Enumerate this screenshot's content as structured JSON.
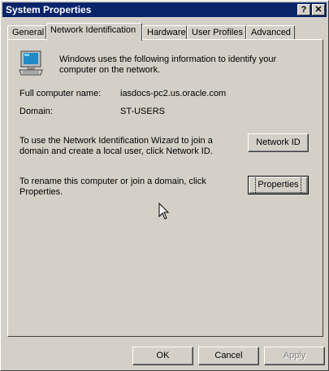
{
  "window": {
    "title": "System Properties",
    "help_button": "?",
    "close_button": "✕"
  },
  "tabs": [
    {
      "label": "General",
      "active": false
    },
    {
      "label": "Network Identification",
      "active": true
    },
    {
      "label": "Hardware",
      "active": false
    },
    {
      "label": "User Profiles",
      "active": false
    },
    {
      "label": "Advanced",
      "active": false
    }
  ],
  "panel": {
    "intro": "Windows uses the following information to identify your computer on the network.",
    "full_name_label": "Full computer name:",
    "full_name_value": "iasdocs-pc2.us.oracle.com",
    "domain_label": "Domain:",
    "domain_value": "ST-USERS",
    "wizard_text": "To use the Network Identification Wizard to join a domain and create a local user, click Network ID.",
    "network_id_button": "Network ID",
    "rename_text": "To rename this computer or join a domain, click Properties.",
    "properties_button": "Properties"
  },
  "footer": {
    "ok": "OK",
    "cancel": "Cancel",
    "apply": "Apply"
  }
}
